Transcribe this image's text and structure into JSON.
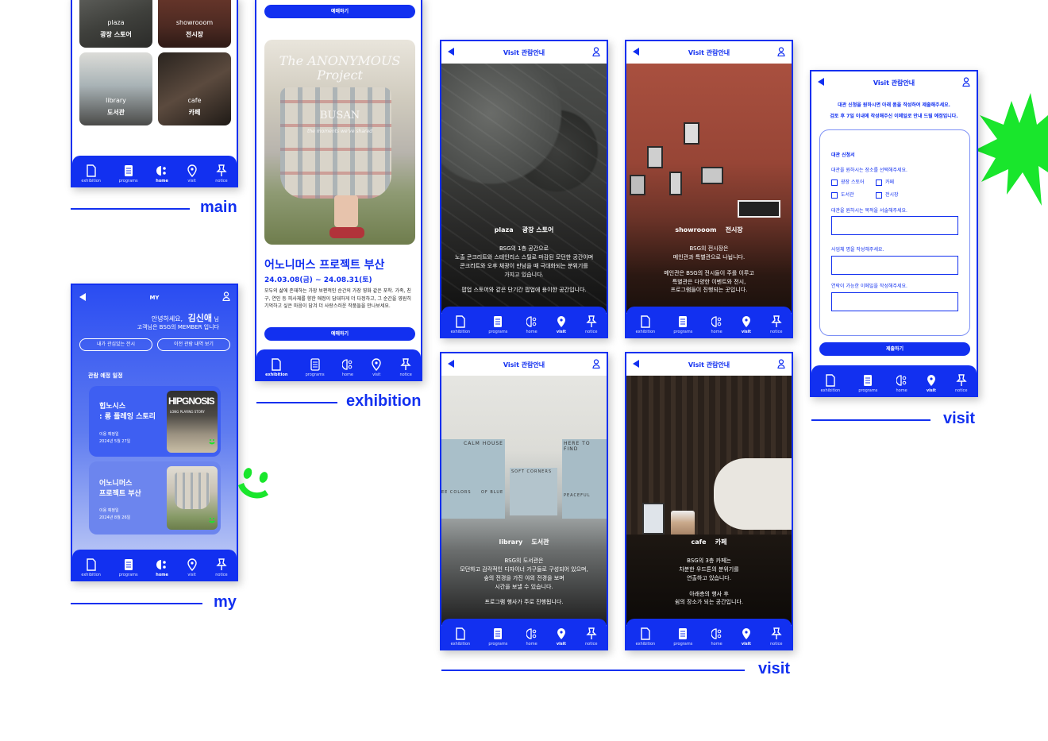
{
  "labels": {
    "main": "main",
    "exhibition": "exhibition",
    "my": "my",
    "visit_top": "visit",
    "visit_bottom": "visit"
  },
  "tabs": [
    "exhibition",
    "programs",
    "home",
    "visit",
    "notice"
  ],
  "main_screen": {
    "tiles": [
      {
        "en": "plaza",
        "ko": "광장 스토어"
      },
      {
        "en": "showrooom",
        "ko": "전시장"
      },
      {
        "en": "library",
        "ko": "도서관"
      },
      {
        "en": "cafe",
        "ko": "카페"
      }
    ]
  },
  "exhibition_screen": {
    "top_button": "예매하기",
    "poster_text_1": "The ANONYMOUS Project",
    "poster_text_2": "BUSAN",
    "poster_caption": "the moments we've shared",
    "title": "어노니머스 프로젝트 부산",
    "dates": "24.03.08(금) ~ 24.08.31(토)",
    "description": "모두의 삶에 존재하는 가장 보편적인 순간의 가장 영화 같은 포착. 가족, 친구, 연인 등 피사체를 향한 애정이 담대하게 더 다정하고, 그 순간을 영원히 기억하고 싶은 마음이 담겨 더 사랑스러운 작품들을 만나보세요.",
    "bottom_button": "예매하기"
  },
  "my_screen": {
    "header": "MY",
    "greeting_1": "안녕하세요,",
    "name": "김신애",
    "honorific": "님",
    "greeting_2": "고객님은 BSG의 MEMBER 입니다",
    "btn_interest": "내가 관심있는 전시",
    "btn_history": "이전 관람 내역 보기",
    "section": "관람 예정 일정",
    "cards": [
      {
        "title_1": "힙노시스",
        "title_2": ": 롱 플레잉 스토리",
        "meta_1": "이용 예정일",
        "meta_2": "2024년 5월 27일",
        "poster": "HIPGNOSIS",
        "poster_sub": "LONG PLAYING STORY"
      },
      {
        "title_1": "어노니머스",
        "title_2": "프로젝트 부산",
        "meta_1": "이용 예정일",
        "meta_2": "2024년 8월 26일"
      }
    ]
  },
  "visit_header": "Visit  관람안내",
  "visit_plaza": {
    "en": "plaza",
    "ko": "광장 스토어",
    "l1": "BSG의 1층 공간으로",
    "l2": "노출 콘크리트와 스테인리스 스틸로 마감된 모던한 공간이며",
    "l3": "콘크리트와 오후 채광이 만남을 때 극대화되는 분위기를",
    "l4": "가지고 있습니다.",
    "l5": "팝업 스토어와 같은 단기간 팝업에 용이한 공간입니다."
  },
  "visit_showroom": {
    "en": "showrooom",
    "ko": "전시장",
    "l1": "BSG의 전시장은",
    "l2": "메인관과 특별관으로 나뉩니다.",
    "l3": "메인관은 BSG의 전시들이 주를 이루고",
    "l4": "특별관은 다양한 이벤트와 전시,",
    "l5": "프로그램들이 진행되는 곳입니다."
  },
  "visit_library": {
    "en": "library",
    "ko": "도서관",
    "l1": "BSG의 도서관은",
    "l2": "모던하고 감각적인 디자이너 가구들로 구성되어 있으며,",
    "l3": "숲의 전경을 가진 야외 전경을 보며",
    "l4": "시간을 보낼 수 있습니다.",
    "l5": "프로그램 행사가 주로 진행됩니다.",
    "wall_1": "CALM HOUSE",
    "wall_2": "HERE TO FIND",
    "wall_3": "SOFT CORNERS",
    "wall_4": "EE COLORS",
    "wall_5": "OF BLUE",
    "wall_6": "PEACEFUL"
  },
  "visit_cafe": {
    "en": "cafe",
    "ko": "카페",
    "l1": "BSG의 3층 카페는",
    "l2": "차분한 우드톤의 분위기를",
    "l3": "연출하고 있습니다.",
    "l4": "아래층의 행사 후",
    "l5": "쉼의 장소가 되는 공간입니다."
  },
  "visit_form": {
    "intro_1": "대관 신청을 원하시면 아래 폼을 작성하여 제출해주세요.",
    "intro_2": "검토 후 7일 이내에 작성해주신 이메일로 안내 드릴 예정입니다.",
    "form_title": "대관 신청서",
    "q1": "대관을 원하시는 장소를 선택해주세요.",
    "options": [
      "광장 스토어",
      "카페",
      "도서관",
      "전시장"
    ],
    "q2": "대관을 원하시는 목적을 서술해주세요.",
    "q3": "사업체 명을 작성해주세요.",
    "q4": "연락이 가능한 이메일을 작성해주세요.",
    "submit": "제출하기"
  },
  "colors": {
    "brand_blue": "#1230f0",
    "accent_green": "#19e62c"
  }
}
